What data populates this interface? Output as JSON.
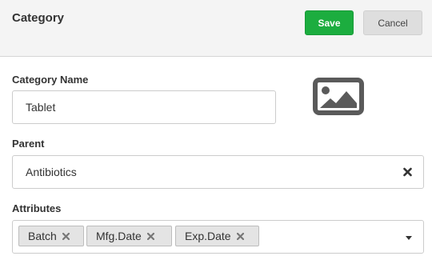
{
  "header": {
    "title": "Category",
    "save_label": "Save",
    "cancel_label": "Cancel"
  },
  "form": {
    "category_name": {
      "label": "Category Name",
      "value": "Tablet"
    },
    "parent": {
      "label": "Parent",
      "value": "Antibiotics"
    },
    "attributes": {
      "label": "Attributes",
      "tags": [
        "Batch",
        "Mfg.Date",
        "Exp.Date"
      ]
    }
  },
  "icons": {
    "image_placeholder": "image-icon",
    "clear": "close-icon",
    "tag_remove": "close-icon",
    "dropdown": "caret-down-icon"
  },
  "colors": {
    "save": "#1cad3f",
    "cancel": "#dedede",
    "header_bg": "#f4f4f4",
    "icon": "#5a5a5a"
  }
}
